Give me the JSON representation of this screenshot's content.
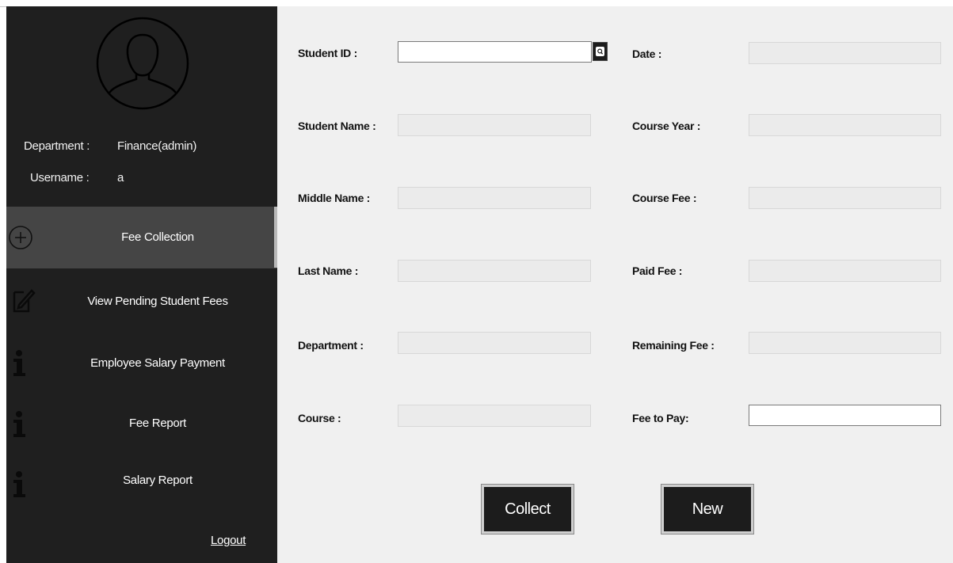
{
  "sidebar": {
    "department_label": "Department :",
    "department_value": "Finance(admin)",
    "username_label": "Username :",
    "username_value": "a",
    "nav": [
      {
        "label": "Fee Collection",
        "icon": "plus-circle-icon",
        "active": true
      },
      {
        "label": "View Pending Student Fees",
        "icon": "edit-icon",
        "active": false
      },
      {
        "label": "Employee Salary Payment",
        "icon": "info-icon",
        "active": false
      },
      {
        "label": "Fee Report",
        "icon": "info-icon",
        "active": false
      },
      {
        "label": "Salary Report",
        "icon": "info-icon",
        "active": false
      }
    ],
    "logout_label": "Logout"
  },
  "form": {
    "student_id": {
      "label": "Student ID :",
      "value": ""
    },
    "student_name": {
      "label": "Student Name :",
      "value": ""
    },
    "middle_name": {
      "label": "Middle Name :",
      "value": ""
    },
    "last_name": {
      "label": "Last Name :",
      "value": ""
    },
    "department": {
      "label": "Department :",
      "value": ""
    },
    "course": {
      "label": "Course :",
      "value": ""
    },
    "date": {
      "label": "Date :",
      "value": ""
    },
    "course_year": {
      "label": "Course Year :",
      "value": ""
    },
    "course_fee": {
      "label": "Course Fee :",
      "value": ""
    },
    "paid_fee": {
      "label": "Paid Fee :",
      "value": ""
    },
    "remaining_fee": {
      "label": "Remaining Fee :",
      "value": ""
    },
    "fee_to_pay": {
      "label": "Fee to Pay:",
      "value": ""
    }
  },
  "actions": {
    "collect_label": "Collect",
    "new_label": "New"
  },
  "colors": {
    "sidebar_bg": "#1f1f1f",
    "active_nav_bg": "#454545",
    "main_bg": "#f0f0f0",
    "button_bg": "#1c1c1c"
  }
}
